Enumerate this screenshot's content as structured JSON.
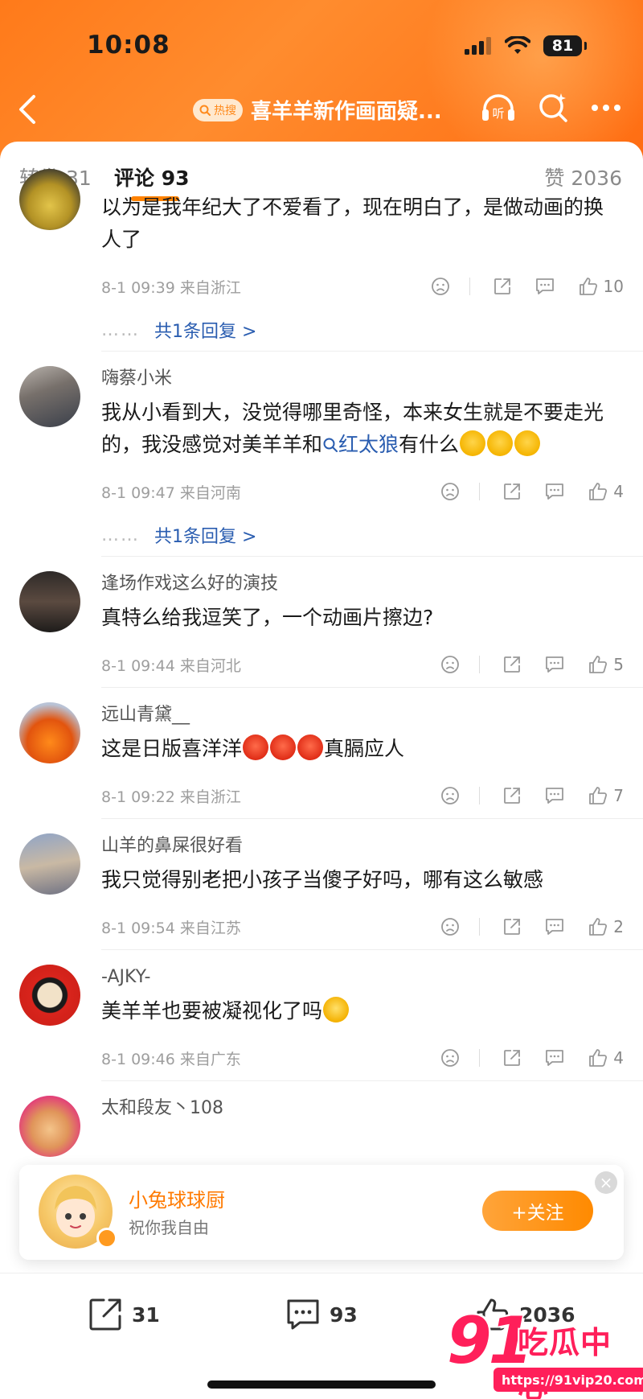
{
  "status_bar": {
    "time": "10:08",
    "battery": "81"
  },
  "nav": {
    "hot_tag": "热搜",
    "title": "喜羊羊新作画面疑...",
    "listen_label": "听"
  },
  "tabs": {
    "repost": "转发 31",
    "comment": "评论 93",
    "like": "赞 2036"
  },
  "comments": [
    {
      "username": "",
      "text": "以为是我年纪大了不爱看了，现在明白了，是做动画的换人了",
      "meta": "8-1 09:39 来自浙江",
      "likes": "10",
      "reply": "共1条回复 >"
    },
    {
      "username": "嗨蔡小米",
      "text_before": "我从小看到大，没觉得哪里奇怪，本来女生就是不要走光的，我没感觉对美羊羊和",
      "link": "红太狼",
      "text_after": "有什么",
      "meta": "8-1 09:47 来自河南",
      "likes": "4",
      "reply": "共1条回复 >"
    },
    {
      "username": "逢场作戏这么好的演技",
      "text": "真特么给我逗笑了，一个动画片擦边?",
      "meta": "8-1 09:44 来自河北",
      "likes": "5"
    },
    {
      "username": "远山青黛__",
      "text_before": "这是日版喜洋洋",
      "text_after": "真膈应人",
      "meta": "8-1 09:22 来自浙江",
      "likes": "7"
    },
    {
      "username": "山羊的鼻屎很好看",
      "text": "我只觉得别老把小孩子当傻子好吗，哪有这么敏感",
      "meta": "8-1 09:54 来自江苏",
      "likes": "2"
    },
    {
      "username": "-AJKY-",
      "text": "美羊羊也要被凝视化了吗",
      "meta": "8-1 09:46 来自广东",
      "likes": "4"
    },
    {
      "username": "太和段友丶108"
    }
  ],
  "follow_popup": {
    "name": "小兔球球厨",
    "subtitle": "祝你我自由",
    "button": "+关注",
    "close": "×"
  },
  "bottom_bar": {
    "repost_count": "31",
    "comment_count": "93",
    "like_count": "2036"
  },
  "watermark": {
    "number": "91",
    "name": "吃瓜中心",
    "url": "https://91vip20.com"
  },
  "colors": {
    "accent": "#ff8200",
    "link": "#2a5db0",
    "header": "#ff7a1a"
  }
}
